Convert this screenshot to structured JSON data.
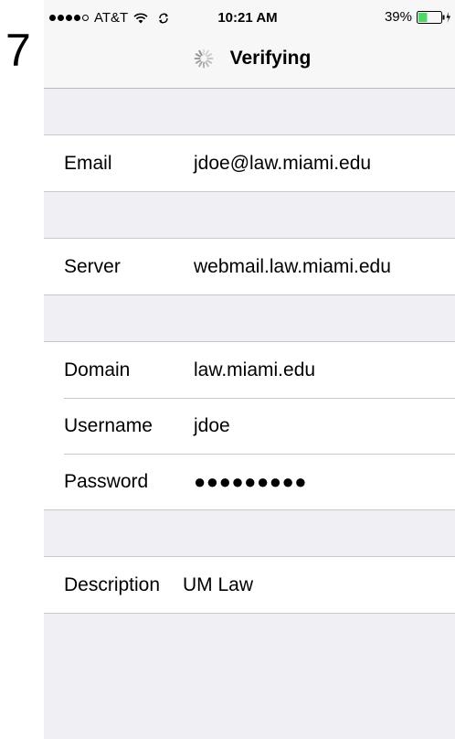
{
  "step_number": "7",
  "status_bar": {
    "carrier": "AT&T",
    "signal_filled": 4,
    "signal_total": 5,
    "time": "10:21 AM",
    "battery_percent": "39%",
    "battery_level": 0.39,
    "battery_color": "#4cd964"
  },
  "navbar": {
    "title": "Verifying",
    "icon": "spinner-icon"
  },
  "fields": {
    "email": {
      "label": "Email",
      "value": "jdoe@law.miami.edu"
    },
    "server": {
      "label": "Server",
      "value": "webmail.law.miami.edu"
    },
    "domain": {
      "label": "Domain",
      "value": "law.miami.edu"
    },
    "username": {
      "label": "Username",
      "value": "jdoe"
    },
    "password": {
      "label": "Password",
      "value": "●●●●●●●●●"
    },
    "description": {
      "label": "Description",
      "value": "UM Law"
    }
  }
}
